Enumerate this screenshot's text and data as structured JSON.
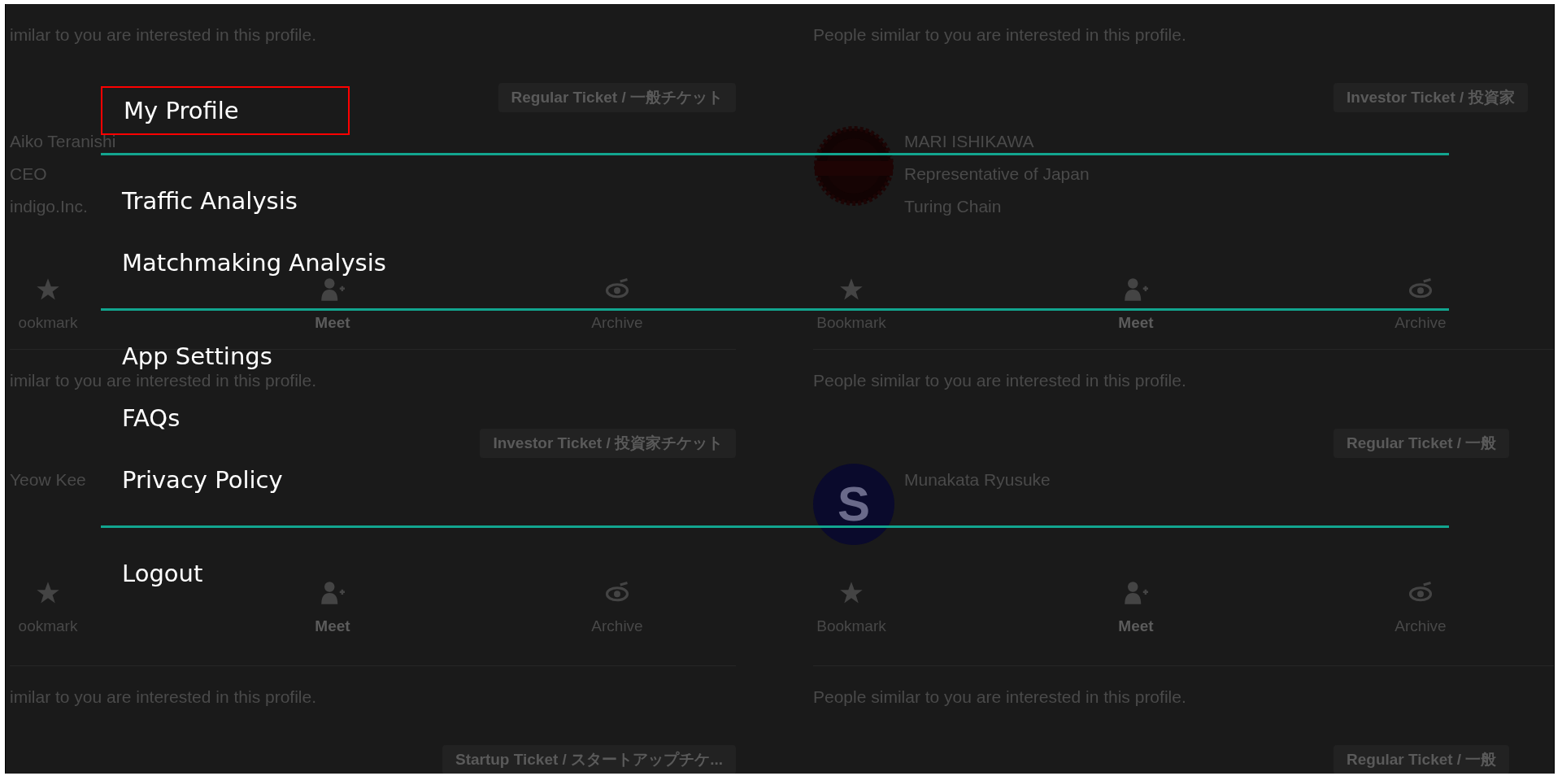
{
  "columns": [
    {
      "cards": [
        {
          "note": "imilar to you are interested in this profile.",
          "ticket": "Regular Ticket / 一般チケット",
          "details": [
            "Aiko Teranishi",
            "CEO",
            "indigo.Inc."
          ],
          "actions": [
            {
              "kind": "bookmark",
              "label": "ookmark",
              "emphasized": false
            },
            {
              "kind": "meet",
              "label": "Meet",
              "emphasized": true
            },
            {
              "kind": "archive",
              "label": "Archive",
              "emphasized": false
            }
          ]
        },
        {
          "note": "imilar to you are interested in this profile.",
          "ticket": "Investor Ticket / 投資家チケット",
          "details": [
            "Yeow Kee"
          ],
          "actions": [
            {
              "kind": "bookmark",
              "label": "ookmark",
              "emphasized": false
            },
            {
              "kind": "meet",
              "label": "Meet",
              "emphasized": true
            },
            {
              "kind": "archive",
              "label": "Archive",
              "emphasized": false
            }
          ]
        },
        {
          "note": "imilar to you are interested in this profile.",
          "ticket": "Startup Ticket / スタートアップチケ..."
        }
      ]
    },
    {
      "cards": [
        {
          "note": "People similar to you are interested in this profile.",
          "ticket": "Investor Ticket / 投資家",
          "avatar": {
            "kind": "logo"
          },
          "details": [
            "MARI ISHIKAWA",
            "Representative of Japan",
            "Turing Chain"
          ],
          "actions": [
            {
              "kind": "bookmark",
              "label": "Bookmark",
              "emphasized": false
            },
            {
              "kind": "meet",
              "label": "Meet",
              "emphasized": true
            },
            {
              "kind": "archive",
              "label": "Archive",
              "emphasized": false
            }
          ]
        },
        {
          "note": "People similar to you are interested in this profile.",
          "ticket": "Regular Ticket / 一般",
          "avatar": {
            "kind": "letter",
            "letter": "S"
          },
          "details": [
            "Munakata Ryusuke"
          ],
          "actions": [
            {
              "kind": "bookmark",
              "label": "Bookmark",
              "emphasized": false
            },
            {
              "kind": "meet",
              "label": "Meet",
              "emphasized": true
            },
            {
              "kind": "archive",
              "label": "Archive",
              "emphasized": false
            }
          ]
        },
        {
          "note": "People similar to you are interested in this profile.",
          "ticket": "Regular Ticket / 一般"
        }
      ]
    }
  ],
  "menu": {
    "groups": [
      {
        "items": [
          {
            "label": "My Profile",
            "selected": true
          }
        ]
      },
      {
        "items": [
          {
            "label": "Traffic Analysis",
            "selected": false
          },
          {
            "label": "Matchmaking Analysis",
            "selected": false
          }
        ]
      },
      {
        "items": [
          {
            "label": "App Settings",
            "selected": false
          },
          {
            "label": "FAQs",
            "selected": false
          },
          {
            "label": "Privacy Policy",
            "selected": false
          }
        ]
      },
      {
        "items": [
          {
            "label": "Logout",
            "selected": false
          }
        ]
      }
    ]
  }
}
